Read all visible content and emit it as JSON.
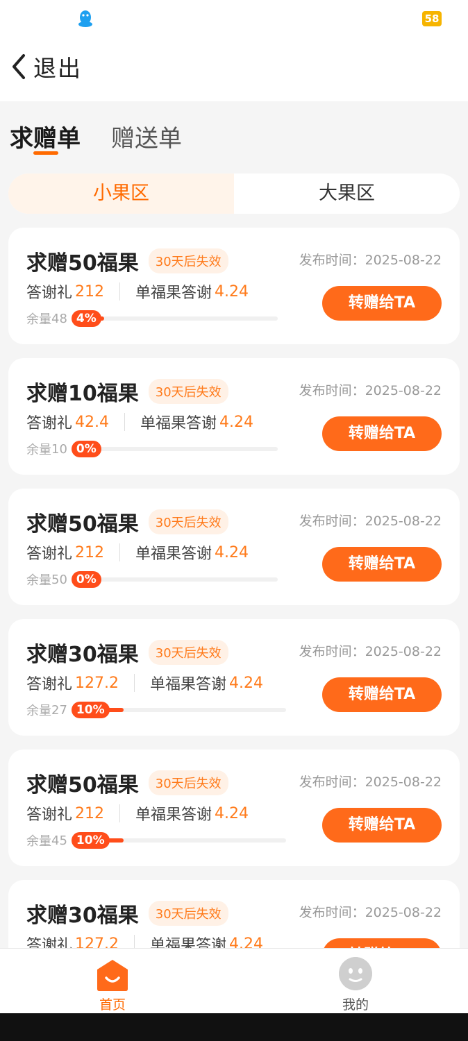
{
  "status_bar": {
    "battery": "58"
  },
  "header": {
    "back_label": "退出"
  },
  "tabs": [
    {
      "label": "求赠单",
      "active": true
    },
    {
      "label": "赠送单",
      "active": false
    }
  ],
  "segments": [
    {
      "label": "小果区",
      "active": true
    },
    {
      "label": "大果区",
      "active": false
    }
  ],
  "publish_prefix": "发布时间：",
  "thanks_label": "答谢礼",
  "unit_thanks_label": "单福果答谢",
  "remaining_prefix": "余量",
  "give_button_label": "转赠给TA",
  "cards": [
    {
      "title": "求赠50福果",
      "expire": "30天后失效",
      "publish_date": "2025-08-22",
      "thanks": "212",
      "unit_thanks": "4.24",
      "remaining": "48",
      "progress": "4%",
      "progress_value": 4
    },
    {
      "title": "求赠10福果",
      "expire": "30天后失效",
      "publish_date": "2025-08-22",
      "thanks": "42.4",
      "unit_thanks": "4.24",
      "remaining": "10",
      "progress": "0%",
      "progress_value": 0
    },
    {
      "title": "求赠50福果",
      "expire": "30天后失效",
      "publish_date": "2025-08-22",
      "thanks": "212",
      "unit_thanks": "4.24",
      "remaining": "50",
      "progress": "0%",
      "progress_value": 0
    },
    {
      "title": "求赠30福果",
      "expire": "30天后失效",
      "publish_date": "2025-08-22",
      "thanks": "127.2",
      "unit_thanks": "4.24",
      "remaining": "27",
      "progress": "10%",
      "progress_value": 10
    },
    {
      "title": "求赠50福果",
      "expire": "30天后失效",
      "publish_date": "2025-08-22",
      "thanks": "212",
      "unit_thanks": "4.24",
      "remaining": "45",
      "progress": "10%",
      "progress_value": 10
    },
    {
      "title": "求赠30福果",
      "expire": "30天后失效",
      "publish_date": "2025-08-22",
      "thanks": "127.2",
      "unit_thanks": "4.24",
      "remaining": "",
      "progress": "",
      "progress_value": 0
    }
  ],
  "bottom_nav": [
    {
      "label": "首页",
      "icon": "home-smile-icon",
      "active": true
    },
    {
      "label": "我的",
      "icon": "profile-face-icon",
      "active": false
    }
  ],
  "colors": {
    "accent": "#ff6a00",
    "button": "#ff6a1a",
    "badge_red": "#ff4d1a"
  }
}
